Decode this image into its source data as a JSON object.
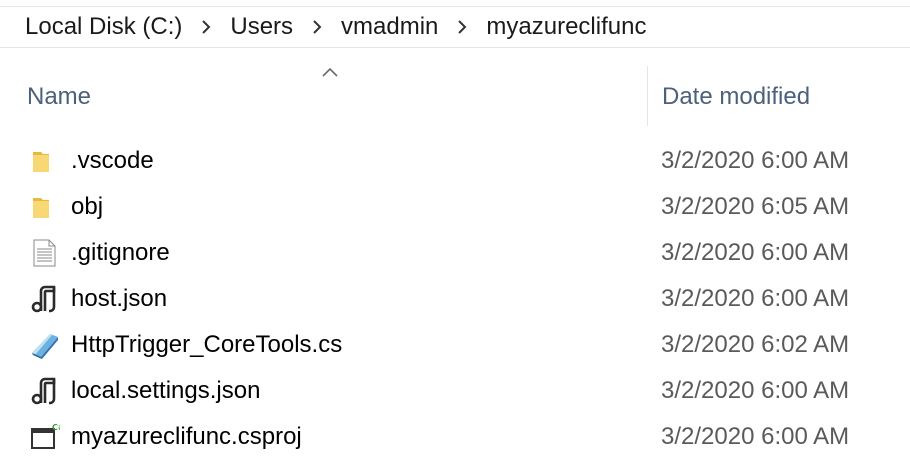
{
  "breadcrumb": {
    "segments": [
      "Local Disk (C:)",
      "Users",
      "vmadmin",
      "myazureclifunc"
    ]
  },
  "columns": {
    "name": "Name",
    "date_modified": "Date modified"
  },
  "files": [
    {
      "name": ".vscode",
      "date": "3/2/2020 6:00 AM",
      "icon": "folder-icon"
    },
    {
      "name": "obj",
      "date": "3/2/2020 6:05 AM",
      "icon": "folder-icon"
    },
    {
      "name": ".gitignore",
      "date": "3/2/2020 6:00 AM",
      "icon": "text-file-icon"
    },
    {
      "name": "host.json",
      "date": "3/2/2020 6:00 AM",
      "icon": "json-file-icon"
    },
    {
      "name": "HttpTrigger_CoreTools.cs",
      "date": "3/2/2020 6:02 AM",
      "icon": "csharp-file-icon"
    },
    {
      "name": "local.settings.json",
      "date": "3/2/2020 6:00 AM",
      "icon": "json-file-icon"
    },
    {
      "name": "myazureclifunc.csproj",
      "date": "3/2/2020 6:00 AM",
      "icon": "csproj-file-icon"
    }
  ],
  "colors": {
    "header_text": "#4c607a",
    "date_text": "#5a5a5a",
    "folder_yellow": "#f8d775",
    "divider": "#e5e5e5"
  }
}
